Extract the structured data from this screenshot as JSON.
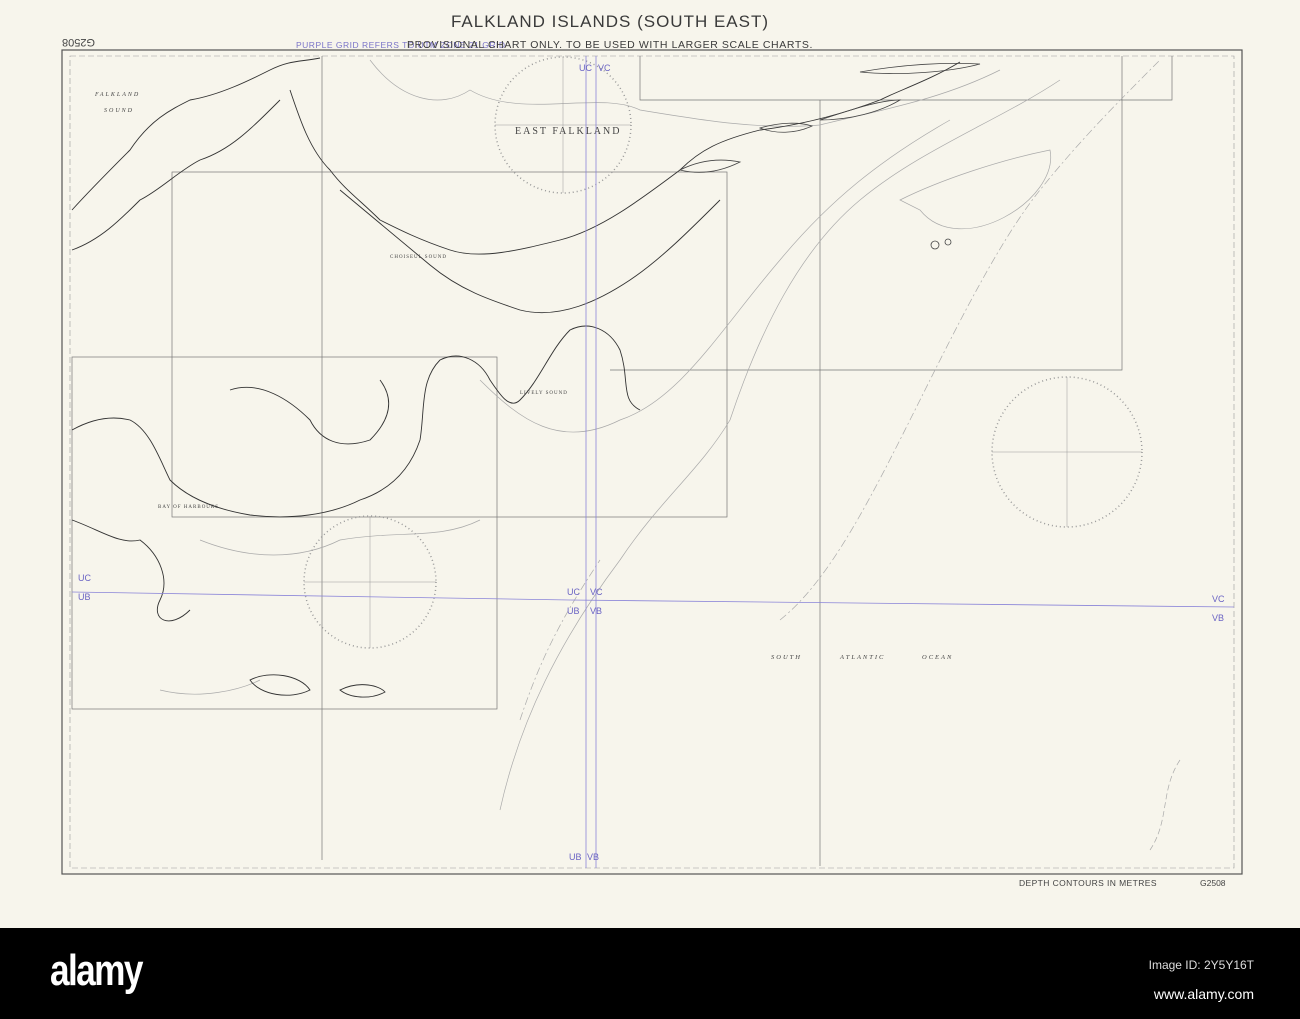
{
  "chart": {
    "title": "FALKLAND ISLANDS (SOUTH EAST)",
    "subtitle": "PROVISIONAL CHART ONLY. TO BE USED WITH LARGER SCALE CHARTS.",
    "grid_note": "PURPLE GRID REFERS TO UTM ZONE 21 GRID",
    "chart_number": "G2508",
    "depth_note": "DEPTH CONTOURS IN METRES",
    "grid_color": "#6b64c4",
    "places": {
      "falkland_sound_1": "FALKLAND",
      "falkland_sound_2": "SOUND",
      "east_falkland": "EAST FALKLAND",
      "choiseul_sound": "CHOISEUL SOUND",
      "lively_sound": "LIVELY SOUND",
      "bay_of_harbours": "BAY OF HARBOURS",
      "south": "SOUTH",
      "atlantic": "ATLANTIC",
      "ocean": "OCEAN"
    },
    "grid_labels": {
      "top_uc": "UC",
      "top_vc": "VC",
      "left_uc": "UC",
      "left_ub": "UB",
      "mid_uc": "UC",
      "mid_vc": "VC",
      "mid_ub": "UB",
      "mid_vb": "VB",
      "right_vc": "VC",
      "right_vb": "VB",
      "bot_ub": "UB",
      "bot_vb": "VB"
    }
  },
  "watermark": {
    "logo": "alamy",
    "image_id": "Image ID: 2Y5Y16T",
    "site": "www.alamy.com"
  }
}
